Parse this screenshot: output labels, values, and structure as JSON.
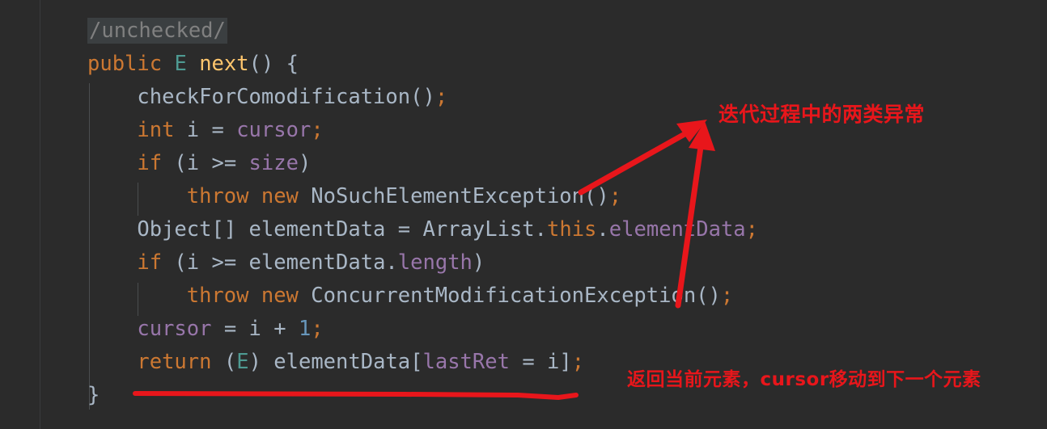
{
  "editor": {
    "theme_background": "#2b2b2b",
    "gutter_divider_color": "#393b3d",
    "code_lines": [
      {
        "id": "line-annotation-unchecked",
        "indent": 0,
        "tokens": [
          {
            "text": "/unchecked/",
            "style": "hl-unchecked"
          }
        ]
      },
      {
        "id": "line-method-signature",
        "indent": 0,
        "tokens": [
          {
            "text": "public",
            "style": "t-keyword"
          },
          {
            "text": " ",
            "style": "t-default"
          },
          {
            "text": "E",
            "style": "t-type"
          },
          {
            "text": " ",
            "style": "t-default"
          },
          {
            "text": "next",
            "style": "t-method"
          },
          {
            "text": "() {",
            "style": "t-punct"
          }
        ]
      },
      {
        "id": "line-check-comodification",
        "indent": 1,
        "tokens": [
          {
            "text": "checkForComodification",
            "style": "t-default"
          },
          {
            "text": "()",
            "style": "t-punct"
          },
          {
            "text": ";",
            "style": "t-semi"
          }
        ]
      },
      {
        "id": "line-int-i-cursor",
        "indent": 1,
        "tokens": [
          {
            "text": "int",
            "style": "t-keyword"
          },
          {
            "text": " i = ",
            "style": "t-default"
          },
          {
            "text": "cursor",
            "style": "t-field"
          },
          {
            "text": ";",
            "style": "t-semi"
          }
        ]
      },
      {
        "id": "line-if-i-ge-size",
        "indent": 1,
        "tokens": [
          {
            "text": "if",
            "style": "t-keyword"
          },
          {
            "text": " (i >= ",
            "style": "t-default"
          },
          {
            "text": "size",
            "style": "t-field"
          },
          {
            "text": ")",
            "style": "t-punct"
          }
        ]
      },
      {
        "id": "line-throw-nosuchelement",
        "indent": 2,
        "tokens": [
          {
            "text": "throw",
            "style": "t-keyword"
          },
          {
            "text": " ",
            "style": "t-default"
          },
          {
            "text": "new",
            "style": "t-keyword"
          },
          {
            "text": " NoSuchElementException",
            "style": "t-default"
          },
          {
            "text": "()",
            "style": "t-punct"
          },
          {
            "text": ";",
            "style": "t-semi"
          }
        ]
      },
      {
        "id": "line-object-array-elementdata",
        "indent": 1,
        "tokens": [
          {
            "text": "Object[] elementData = ArrayList.",
            "style": "t-default"
          },
          {
            "text": "this",
            "style": "t-keyword"
          },
          {
            "text": ".",
            "style": "t-default"
          },
          {
            "text": "elementData",
            "style": "t-field"
          },
          {
            "text": ";",
            "style": "t-semi"
          }
        ]
      },
      {
        "id": "line-if-i-ge-length",
        "indent": 1,
        "tokens": [
          {
            "text": "if",
            "style": "t-keyword"
          },
          {
            "text": " (i >= elementData.",
            "style": "t-default"
          },
          {
            "text": "length",
            "style": "t-field"
          },
          {
            "text": ")",
            "style": "t-punct"
          }
        ]
      },
      {
        "id": "line-throw-concurrentmodification",
        "indent": 2,
        "tokens": [
          {
            "text": "throw",
            "style": "t-keyword"
          },
          {
            "text": " ",
            "style": "t-default"
          },
          {
            "text": "new",
            "style": "t-keyword"
          },
          {
            "text": " ConcurrentModificationException",
            "style": "t-default"
          },
          {
            "text": "()",
            "style": "t-punct"
          },
          {
            "text": ";",
            "style": "t-semi"
          }
        ]
      },
      {
        "id": "line-cursor-assign",
        "indent": 1,
        "tokens": [
          {
            "text": "cursor",
            "style": "t-field"
          },
          {
            "text": " = i + ",
            "style": "t-default"
          },
          {
            "text": "1",
            "style": "t-number"
          },
          {
            "text": ";",
            "style": "t-semi"
          }
        ]
      },
      {
        "id": "line-return-elementdata",
        "indent": 1,
        "tokens": [
          {
            "text": "return",
            "style": "t-keyword"
          },
          {
            "text": " (",
            "style": "t-punct"
          },
          {
            "text": "E",
            "style": "t-type"
          },
          {
            "text": ") elementData[",
            "style": "t-default"
          },
          {
            "text": "lastRet",
            "style": "t-field"
          },
          {
            "text": " = i]",
            "style": "t-default"
          },
          {
            "text": ";",
            "style": "t-semi"
          }
        ]
      },
      {
        "id": "line-closing-brace",
        "indent": 0,
        "tokens": [
          {
            "text": "}",
            "style": "t-punct"
          }
        ]
      }
    ]
  },
  "annotations": {
    "color": "#e8161b",
    "note_exceptions": "迭代过程中的两类异常",
    "note_return": "返回当前元素，cursor移动到下一个元素",
    "arrow_from_nosuchelement": "arrow pointing from NoSuchElementException line to exception note",
    "arrow_from_concurrentmodification": "arrow pointing from ConcurrentModificationException line to exception note",
    "underline_return_line": "red underline beneath the return statement"
  }
}
